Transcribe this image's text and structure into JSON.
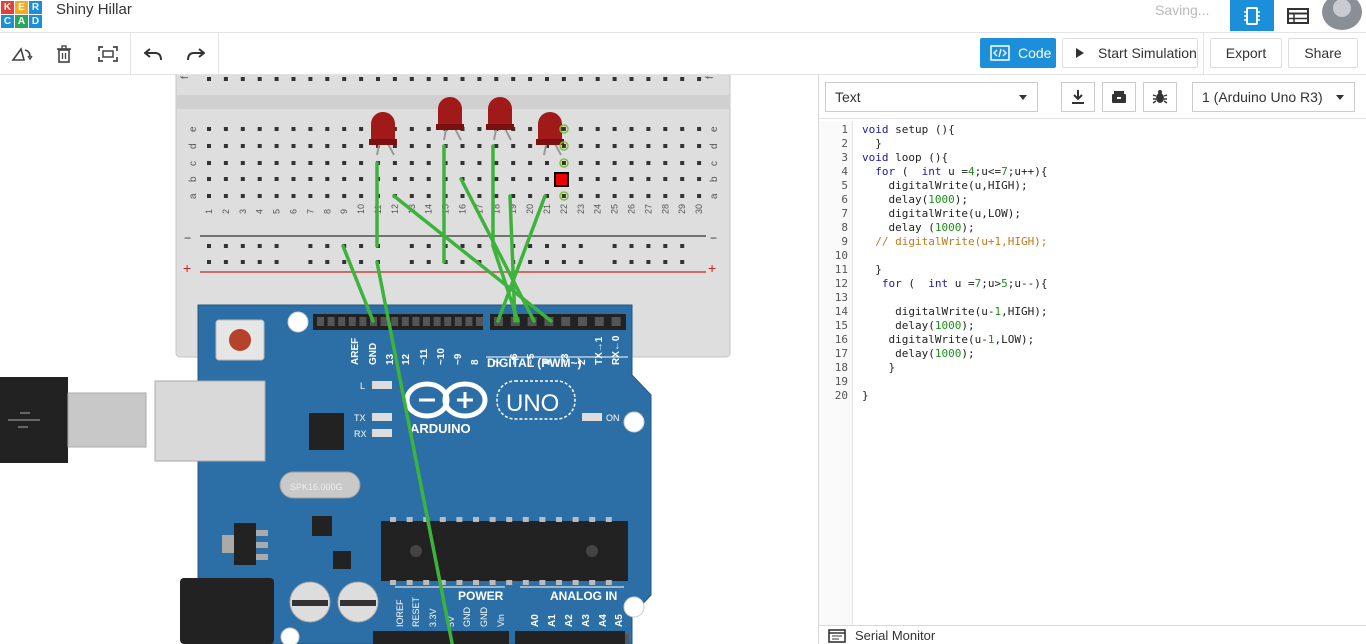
{
  "app": {
    "logo_letters": [
      "K",
      "E",
      "R",
      "C",
      "A",
      "D"
    ],
    "project_title": "Shiny Hillar",
    "status": "Saving...",
    "brand_color": "#1b8fd9"
  },
  "toolbar": {
    "tools": [
      "rotate-icon",
      "trash-icon",
      "fit-view-icon",
      "undo-icon",
      "redo-icon"
    ],
    "code_label": "Code",
    "start_sim_label": "Start Simulation",
    "export_label": "Export",
    "share_label": "Share"
  },
  "code_panel": {
    "mode_select": "Text",
    "device_select": "1 (Arduino Uno R3)",
    "icons": [
      "download-icon",
      "library-icon",
      "debug-icon"
    ],
    "lines": [
      "void setup (){",
      "  }",
      "void loop (){",
      "  for (  int u =4;u<=7;u++){",
      "    digitalWrite(u,HIGH);",
      "    delay(1000);",
      "    digitalWrite(u,LOW);",
      "    delay (1000);",
      "  // digitalWrite(u+1,HIGH);",
      "",
      "  }",
      "   for (  int u =7;u>5;u--){",
      "",
      "     digitalWrite(u-1,HIGH);",
      "     delay(1000);",
      "    digitalWrite(u-1,LOW);",
      "     delay(1000);",
      "    }",
      "",
      "}"
    ],
    "serial_monitor_label": "Serial Monitor"
  },
  "breadboard": {
    "row_letters_top": [
      "f"
    ],
    "row_letters": [
      "e",
      "d",
      "c",
      "b",
      "a"
    ],
    "column_numbers": [
      "1",
      "2",
      "3",
      "4",
      "5",
      "6",
      "7",
      "8",
      "9",
      "10",
      "11",
      "12",
      "13",
      "14",
      "15",
      "16",
      "17",
      "18",
      "19",
      "20",
      "21",
      "22",
      "23",
      "24",
      "25",
      "26",
      "27",
      "28",
      "29",
      "30"
    ],
    "rail_minus": "−",
    "rail_plus": "+"
  },
  "arduino": {
    "board_name": "UNO",
    "brand": "ARDUINO",
    "digital_label": "DIGITAL (PWM~)",
    "power_label": "POWER",
    "analog_label": "ANALOG IN",
    "led_label": "L",
    "tx_label": "TX",
    "rx_label": "RX",
    "on_label": "ON",
    "crystal_label": "SPK16.000G",
    "digital_pins": [
      "AREF",
      "GND",
      "13",
      "12",
      "~11",
      "~10",
      "~9",
      "8",
      "7",
      "~6",
      "~5",
      "4",
      "~3",
      "2",
      "TX→1",
      "RX←0"
    ],
    "power_pins": [
      "IOREF",
      "RESET",
      "3.3V",
      "5V",
      "GND",
      "GND",
      "Vin"
    ],
    "analog_pins": [
      "A0",
      "A1",
      "A2",
      "A3",
      "A4",
      "A5"
    ]
  }
}
